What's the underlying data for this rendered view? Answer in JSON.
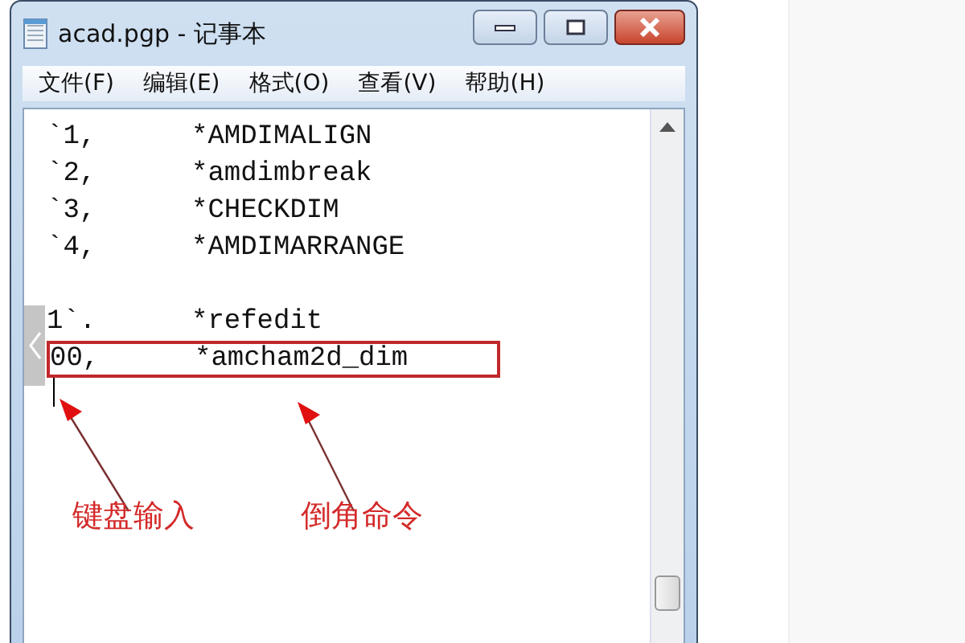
{
  "window": {
    "title": "acad.pgp - 记事本"
  },
  "menu": [
    "文件(F)",
    "编辑(E)",
    "格式(O)",
    "查看(V)",
    "帮助(H)"
  ],
  "lines": [
    {
      "kind": "entry",
      "number": "`1,",
      "command": "*AMDIMALIGN",
      "highlighted": false
    },
    {
      "kind": "entry",
      "number": "`2,",
      "command": "*amdimbreak",
      "highlighted": false
    },
    {
      "kind": "entry",
      "number": "`3,",
      "command": "*CHECKDIM",
      "highlighted": false
    },
    {
      "kind": "entry",
      "number": "`4,",
      "command": "*AMDIMARRANGE",
      "highlighted": false
    },
    {
      "kind": "blank"
    },
    {
      "kind": "entry",
      "number": "1`.",
      "command": "*refedit",
      "highlighted": false
    },
    {
      "kind": "entry",
      "number": "00,",
      "command": "*amcham2d_dim",
      "highlighted": true
    }
  ],
  "annotations": [
    "键盘输入",
    "倒角命令"
  ]
}
